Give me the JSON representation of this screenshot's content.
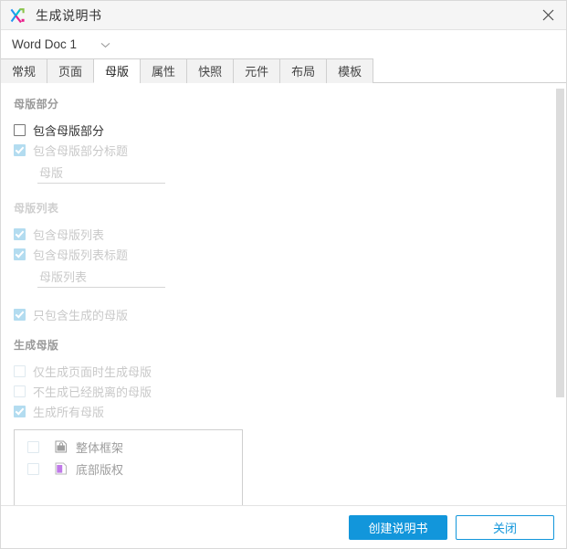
{
  "window": {
    "title": "生成说明书",
    "app_icon": "axure-logo-icon",
    "close_icon": "close-icon"
  },
  "doc_selector": {
    "value": "Word Doc 1",
    "caret_icon": "chevron-down-icon"
  },
  "tabs": [
    {
      "label": "常规",
      "active": false
    },
    {
      "label": "页面",
      "active": false
    },
    {
      "label": "母版",
      "active": true
    },
    {
      "label": "属性",
      "active": false
    },
    {
      "label": "快照",
      "active": false
    },
    {
      "label": "元件",
      "active": false
    },
    {
      "label": "布局",
      "active": false
    },
    {
      "label": "模板",
      "active": false
    }
  ],
  "sections": {
    "master_section": {
      "title": "母版部分",
      "include_master_section": {
        "label": "包含母版部分",
        "checked": false,
        "disabled": false
      },
      "include_master_section_heading": {
        "label": "包含母版部分标题",
        "checked": true,
        "disabled": true
      },
      "heading_input": {
        "value": "母版",
        "placeholder": "母版"
      }
    },
    "master_list": {
      "title": "母版列表",
      "include_master_list": {
        "label": "包含母版列表",
        "checked": true,
        "disabled": true
      },
      "include_master_list_heading": {
        "label": "包含母版列表标题",
        "checked": true,
        "disabled": true
      },
      "list_heading_input": {
        "value": "母版列表",
        "placeholder": "母版列表"
      },
      "only_generated_masters": {
        "label": "只包含生成的母版",
        "checked": true,
        "disabled": true
      }
    },
    "generate_masters": {
      "title": "生成母版",
      "only_when_generating_pages": {
        "label": "仅生成页面时生成母版",
        "checked": false,
        "disabled": true
      },
      "skip_detached_masters": {
        "label": "不生成已经脱离的母版",
        "checked": false,
        "disabled": true
      },
      "generate_all_masters": {
        "label": "生成所有母版",
        "checked": true,
        "disabled": true
      },
      "master_items": [
        {
          "label": "整体框架",
          "checked": false,
          "icon": "master-lock-icon",
          "icon_color": "#9e9e9e"
        },
        {
          "label": "底部版权",
          "checked": false,
          "icon": "master-page-icon",
          "icon_color": "#c07ae8"
        }
      ]
    }
  },
  "footer": {
    "primary_button": "创建说明书",
    "secondary_button": "关闭"
  },
  "colors": {
    "accent": "#1296db",
    "checkbox_disabled_fill": "#b3dcf0",
    "disabled_text": "#c9c9c9",
    "section_title": "#9a9a9a",
    "scrollbar_thumb": "#dcdcdc",
    "titlebar_bg": "#f5f5f5",
    "tab_inactive_bg": "#f2f2f2"
  }
}
